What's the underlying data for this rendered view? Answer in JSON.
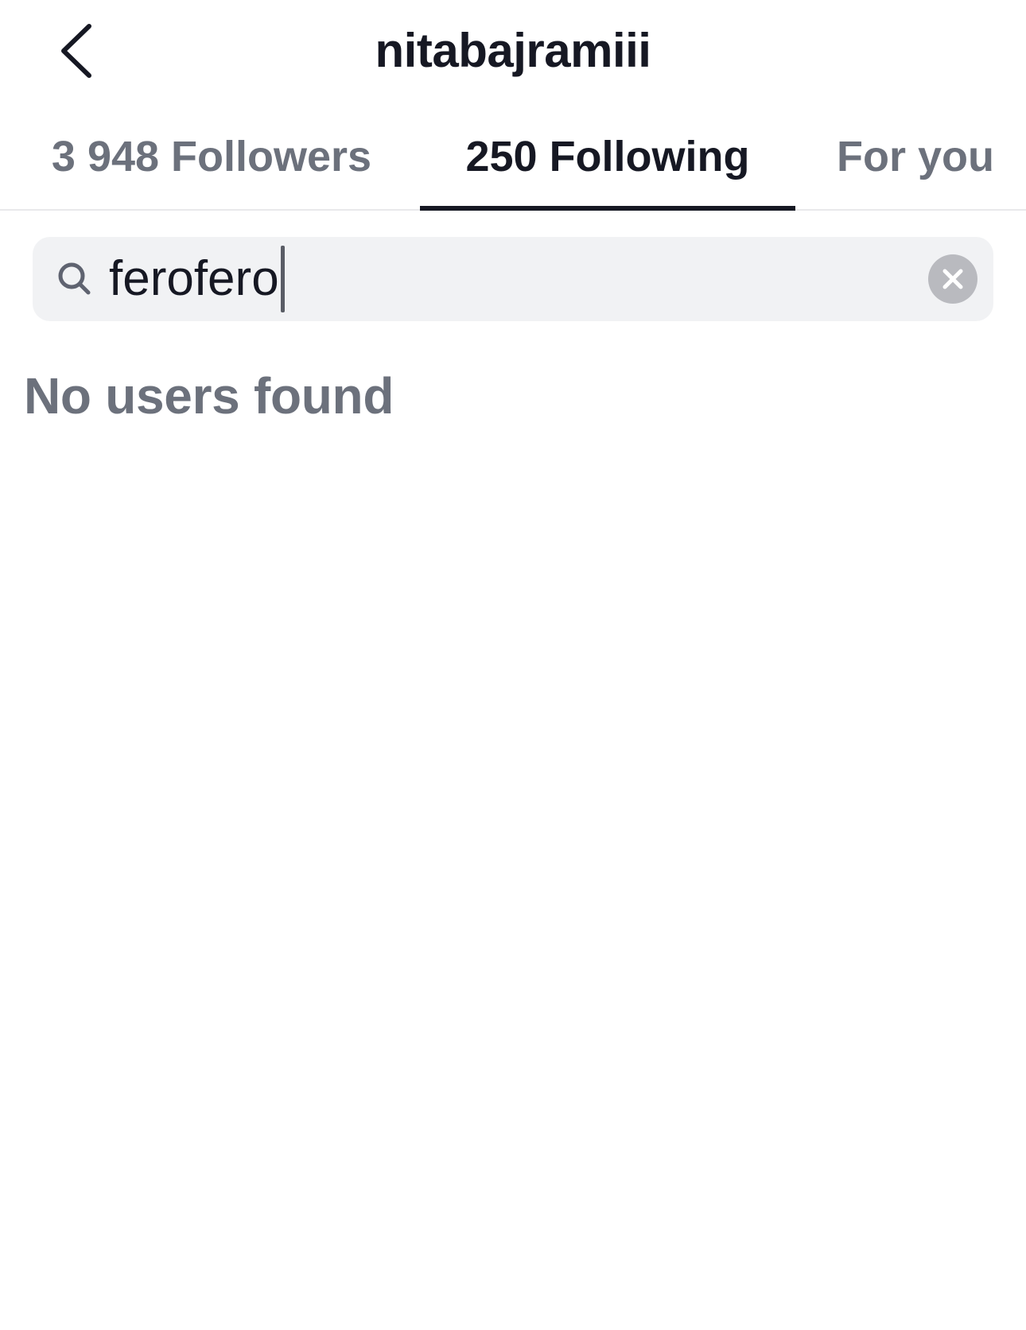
{
  "header": {
    "title": "nitabajramiii",
    "back_icon": "chevron-left-icon"
  },
  "tabs": [
    {
      "label": "3 948 Followers",
      "active": false
    },
    {
      "label": "250 Following",
      "active": true
    },
    {
      "label": "For you",
      "active": false
    }
  ],
  "search": {
    "value": "ferofero",
    "icon": "search-icon",
    "clear_icon": "close-icon"
  },
  "results": {
    "empty_message": "No users found"
  },
  "colors": {
    "primary_text": "#161823",
    "secondary_text": "#6c717c",
    "search_bg": "#f1f2f4",
    "clear_bg": "#b9babf",
    "divider": "#e9e9eb"
  }
}
